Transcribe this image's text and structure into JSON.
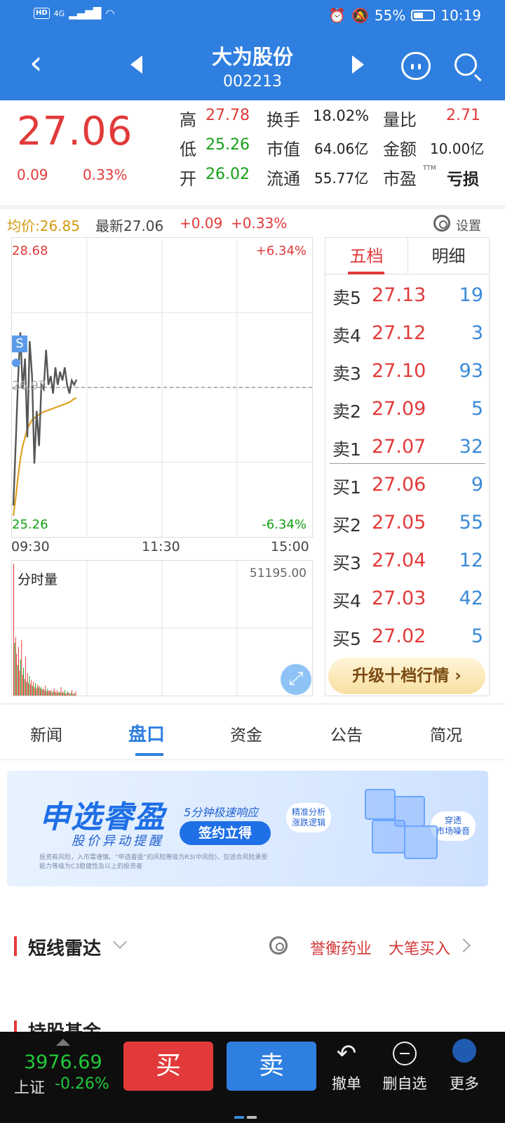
{
  "status_bar": {
    "network_badge": "HD",
    "signal": "4G",
    "battery": "55%",
    "time": "10:19"
  },
  "nav": {
    "title": "大为股份",
    "code": "002213"
  },
  "quote": {
    "price": "27.06",
    "change": "0.09",
    "change_pct": "0.33%",
    "high_label": "高",
    "high": "27.78",
    "low_label": "低",
    "low": "25.26",
    "open_label": "开",
    "open": "26.02",
    "turnover_label": "换手",
    "turnover": "18.02%",
    "mktcap_label": "市值",
    "mktcap": "64.06亿",
    "float_label": "流通",
    "float": "55.77亿",
    "vol_ratio_label": "量比",
    "vol_ratio": "2.71",
    "amount_label": "金额",
    "amount": "10.00亿",
    "pe_label": "市盈",
    "pe_sup": "TTM",
    "pe": "亏损"
  },
  "info_row": {
    "avg": "均价:26.85",
    "latest": "最新27.06",
    "chg": "+0.09",
    "pct": "+0.33%",
    "settings": "设置"
  },
  "chart": {
    "top_price": "28.68",
    "bottom_price": "25.26",
    "top_pct": "+6.34%",
    "bottom_pct": "-6.34%",
    "ref_price": "26.97",
    "marker": "S",
    "times": [
      "09:30",
      "11:30",
      "15:00"
    ],
    "volume_label": "分时量",
    "volume_max": "51195.00"
  },
  "chart_data": {
    "type": "line",
    "title": "",
    "xlabel": "",
    "ylabel": "",
    "x_ticks": [
      "09:30",
      "11:30",
      "15:00"
    ],
    "ylim": [
      25.26,
      28.68
    ],
    "reference": 26.97,
    "series": [
      {
        "name": "",
        "color": "#555555",
        "values": [
          25.62,
          26.3,
          27.05,
          27.6,
          26.95,
          27.3,
          26.4,
          27.5,
          27.1,
          26.1,
          26.7,
          26.3,
          27.0,
          26.95,
          27.4,
          27.0,
          27.1,
          26.9,
          27.2,
          27.0,
          27.15,
          27.05,
          27.2,
          27.0,
          26.9,
          27.05,
          27.0,
          27.06
        ]
      },
      {
        "name": "",
        "color": "#e0a020",
        "values": [
          25.5,
          25.7,
          25.95,
          26.15,
          26.3,
          26.4,
          26.5,
          26.55,
          26.6,
          26.62,
          26.64,
          26.66,
          26.68,
          26.69,
          26.7,
          26.71,
          26.72,
          26.73,
          26.74,
          26.75,
          26.76,
          26.77,
          26.78,
          26.79,
          26.8,
          26.82,
          26.84,
          26.85
        ]
      }
    ],
    "volume": [
      95,
      38,
      42,
      30,
      22,
      35,
      18,
      26,
      40,
      15,
      20,
      12,
      28,
      10,
      16,
      9,
      14,
      8,
      11,
      7,
      10,
      6,
      9,
      5,
      8,
      6,
      7,
      5,
      6,
      4,
      5,
      4,
      7,
      3,
      5,
      3,
      4,
      3,
      4,
      2,
      3,
      5,
      3,
      2,
      4,
      2,
      3,
      2,
      6,
      2,
      3,
      2,
      4,
      1,
      2,
      3,
      2,
      1,
      2,
      4,
      1,
      2,
      1,
      3
    ],
    "grid": true
  },
  "book": {
    "tab_active": "五档",
    "tab_other": "明细",
    "asks": [
      {
        "label": "卖5",
        "price": "27.13",
        "vol": "19"
      },
      {
        "label": "卖4",
        "price": "27.12",
        "vol": "3"
      },
      {
        "label": "卖3",
        "price": "27.10",
        "vol": "93"
      },
      {
        "label": "卖2",
        "price": "27.09",
        "vol": "5"
      },
      {
        "label": "卖1",
        "price": "27.07",
        "vol": "32"
      }
    ],
    "bids": [
      {
        "label": "买1",
        "price": "27.06",
        "vol": "9"
      },
      {
        "label": "买2",
        "price": "27.05",
        "vol": "55"
      },
      {
        "label": "买3",
        "price": "27.04",
        "vol": "12"
      },
      {
        "label": "买4",
        "price": "27.03",
        "vol": "42"
      },
      {
        "label": "买5",
        "price": "27.02",
        "vol": "5"
      }
    ],
    "upgrade": "升级十档行情 ›"
  },
  "tabs": [
    "新闻",
    "盘口",
    "资金",
    "公告",
    "简况"
  ],
  "banner": {
    "brand": "申选睿盈",
    "sub": "股价异动提醒",
    "speed": "5分钟极速响应",
    "button": "签约立得",
    "bubble1": "精准分析\n涨跌逻辑",
    "bubble2": "穿透\n市场噪音",
    "disclaimer": "投资有风险，入市需谨慎。“申选睿盈”的风险等级为R3(中风险)，仅适合风险承受能力等级为C3稳健性及以上的投资者"
  },
  "radar": {
    "title": "短线雷达",
    "stock": "誉衡药业",
    "event": "大笔买入"
  },
  "fund": {
    "title": "持股基金"
  },
  "bottom": {
    "index_value": "3976.69",
    "index_name": "上证",
    "index_pct": "-0.26%",
    "buy": "买",
    "sell": "卖",
    "undo": "撤单",
    "remove": "删自选",
    "more": "更多"
  }
}
